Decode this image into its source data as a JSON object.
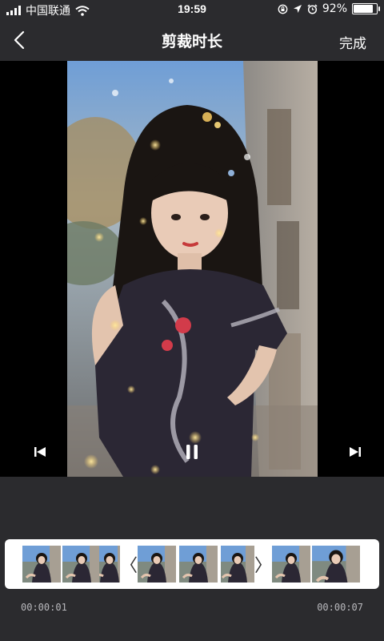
{
  "status_bar": {
    "carrier": "中国联通",
    "time": "19:59",
    "battery_percent": "92%",
    "battery_level": 0.92,
    "icons": [
      "signal-icon",
      "wifi-icon",
      "rotation-lock-icon",
      "location-icon",
      "alarm-icon",
      "battery-icon"
    ]
  },
  "nav": {
    "back_icon": "chevron-left-icon",
    "title": "剪裁时长",
    "done_label": "完成"
  },
  "player": {
    "prev_icon": "skip-previous-icon",
    "pause_icon": "pause-icon",
    "next_icon": "skip-next-icon",
    "frame_description": "video-frame"
  },
  "trim": {
    "start_time": "00:00:01",
    "end_time": "00:00:07",
    "left_handle": "〈",
    "right_handle": "〉",
    "thumbnail_count": 8
  },
  "colors": {
    "background": "#2b2b2e",
    "video_bg": "#000000",
    "strip_bg": "#ffffff",
    "time_text": "#b9b9bd"
  }
}
